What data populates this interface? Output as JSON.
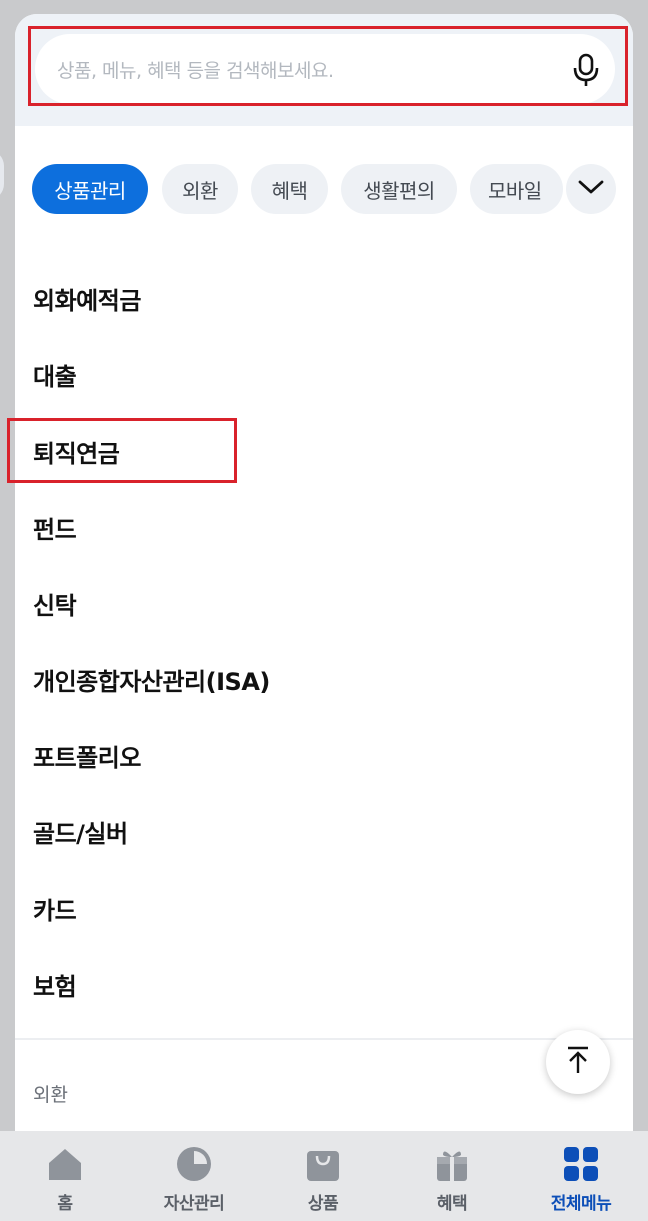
{
  "search": {
    "placeholder": "상품, 메뉴, 혜택 등을 검색해보세요.",
    "mic_icon": "microphone-icon"
  },
  "chips": [
    {
      "label": "상품관리",
      "active": true
    },
    {
      "label": "외환",
      "active": false
    },
    {
      "label": "혜택",
      "active": false
    },
    {
      "label": "생활편의",
      "active": false
    },
    {
      "label": "모바일",
      "active": false
    }
  ],
  "chip_more_icon": "chevron-down-icon",
  "menu_items": [
    "외화예적금",
    "대출",
    "퇴직연금",
    "펀드",
    "신탁",
    "개인종합자산관리(ISA)",
    "포트폴리오",
    "골드/실버",
    "카드",
    "보험"
  ],
  "next_section_label": "외환",
  "scroll_top_icon": "arrow-up-icon",
  "tabs": [
    {
      "label": "홈",
      "icon": "home-icon",
      "active": false
    },
    {
      "label": "자산관리",
      "icon": "pie-chart-icon",
      "active": false
    },
    {
      "label": "상품",
      "icon": "shopping-bag-icon",
      "active": false
    },
    {
      "label": "혜택",
      "icon": "gift-icon",
      "active": false
    },
    {
      "label": "전체메뉴",
      "icon": "grid-menu-icon",
      "active": true
    }
  ],
  "colors": {
    "accent": "#0d6fdd",
    "highlight_outline": "#d9222b",
    "active_tab": "#0d4fb8"
  }
}
